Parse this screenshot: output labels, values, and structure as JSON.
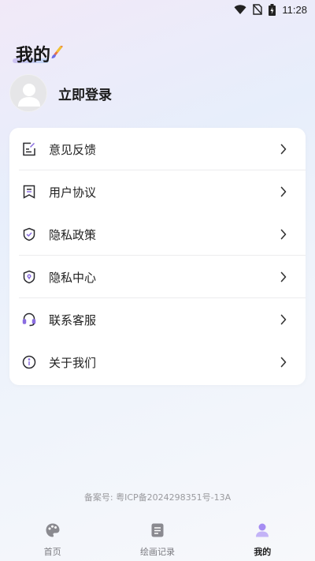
{
  "status_bar": {
    "time": "11:28"
  },
  "header": {
    "title": "我的"
  },
  "profile": {
    "login_label": "立即登录"
  },
  "menu": {
    "items": [
      {
        "label": "意见反馈",
        "icon": "feedback-icon"
      },
      {
        "label": "用户协议",
        "icon": "agreement-icon"
      },
      {
        "label": "隐私政策",
        "icon": "privacy-shield-icon"
      },
      {
        "label": "隐私中心",
        "icon": "location-shield-icon"
      },
      {
        "label": "联系客服",
        "icon": "headset-icon"
      },
      {
        "label": "关于我们",
        "icon": "info-icon"
      }
    ]
  },
  "footer": {
    "icp": "备案号: 粤ICP备2024298351号-13A"
  },
  "tabbar": {
    "tabs": [
      {
        "label": "首页",
        "icon": "palette-icon",
        "active": false
      },
      {
        "label": "绘画记录",
        "icon": "document-icon",
        "active": false
      },
      {
        "label": "我的",
        "icon": "user-icon",
        "active": true
      }
    ]
  },
  "colors": {
    "accent": "#a58cf2",
    "accent_light": "#c3b3f7"
  }
}
